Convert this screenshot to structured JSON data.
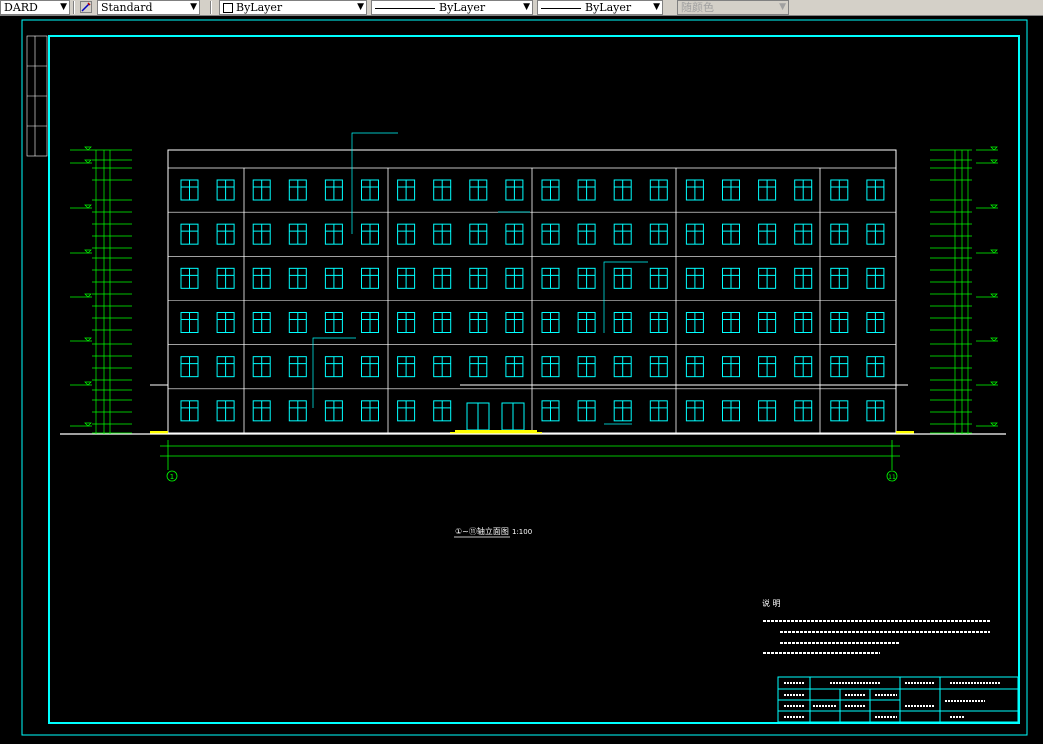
{
  "toolbar": {
    "textstyle_partial": "DARD",
    "dimstyle": "Standard",
    "layer": "ByLayer",
    "linetype": "ByLayer",
    "lineweight": "ByLayer",
    "plotstyle": "随颜色"
  },
  "colors": {
    "frame": "#00ffff",
    "window": "#00ffff",
    "dimension": "#00ff00",
    "building": "#ffffff",
    "annotation": "#00ffff",
    "ground_hatch": "#ffff00",
    "background": "#000000"
  },
  "icons": [
    "dropdown-arrow-icon",
    "text-style-icon",
    "color-swatch-icon"
  ],
  "drawing": {
    "title_caption": "①~⑪轴立面图",
    "scale": "1:100",
    "axis_left": "1",
    "axis_right": "11",
    "storeys": 6,
    "window_columns": 20,
    "notes_title": "说    明"
  }
}
